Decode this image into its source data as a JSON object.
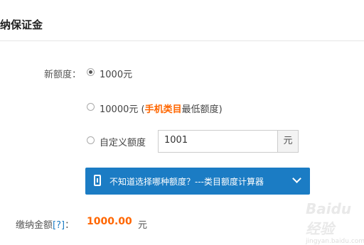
{
  "header": {
    "title": "纳保证金"
  },
  "form": {
    "quota_label": "新额度：",
    "options": [
      {
        "label": "1000元",
        "checked": true
      },
      {
        "label_prefix": "10000元 (",
        "label_highlight": "手机类目",
        "label_suffix": "最低额度)",
        "checked": false
      },
      {
        "label": "自定义额度",
        "checked": false
      }
    ],
    "custom_input_value": "1001",
    "custom_input_unit": "元"
  },
  "calculator": {
    "label": "不知道选择哪种额度？---类目额度计算器",
    "icon": "calculator-icon",
    "chevron": "chevron-down-icon"
  },
  "payment": {
    "label": "缴纳金额",
    "help": "[?]",
    "colon": "：",
    "amount": "1000.00",
    "unit": "元"
  },
  "colors": {
    "accent": "#1b7cc4",
    "highlight": "#ff6600"
  },
  "watermark": {
    "text": "Baidu经验",
    "sub": "jingyan.baidu.com"
  }
}
